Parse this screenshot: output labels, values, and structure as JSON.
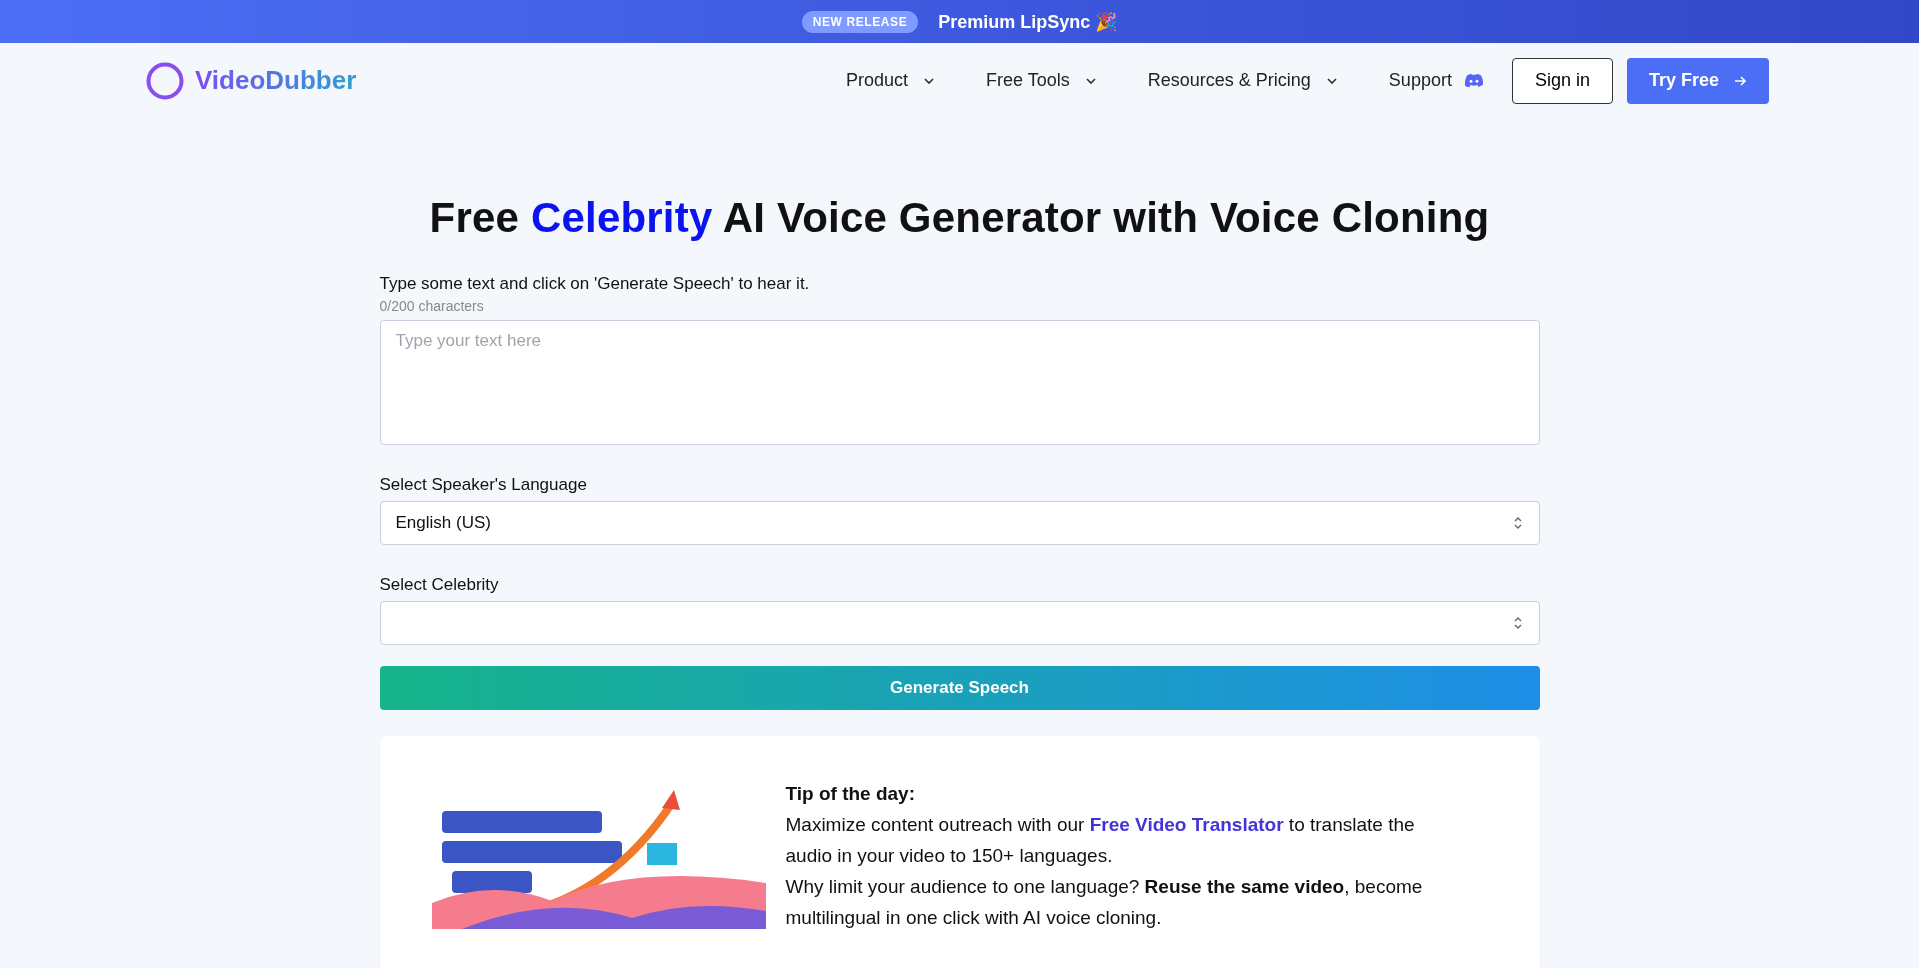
{
  "announcement": {
    "badge": "NEW RELEASE",
    "text": "Premium LipSync 🎉"
  },
  "nav": {
    "logo": "VideoDubber",
    "menus": [
      {
        "label": "Product",
        "dropdown": true
      },
      {
        "label": "Free Tools",
        "dropdown": true
      },
      {
        "label": "Resources & Pricing",
        "dropdown": true
      },
      {
        "label": "Support",
        "dropdown": false
      }
    ],
    "sign_in": "Sign in",
    "try_free": "Try Free"
  },
  "heading": [
    {
      "text": "Free ",
      "highlight": false
    },
    {
      "text": "Celebrity",
      "highlight": true
    },
    {
      "text": " AI Voice Generator with Voice Cloning",
      "highlight": false
    }
  ],
  "form": {
    "instruction": "Type some text and click on 'Generate Speech' to hear it.",
    "counter": "0/200 characters",
    "text_placeholder": "Type your text here",
    "language_label": "Select Speaker's Language",
    "language_value": "English (US)",
    "celebrity_label": "Select Celebrity",
    "generate_button": "Generate Speech"
  },
  "tip": {
    "title": "Tip of the day:",
    "paragraphs": [
      [
        {
          "kind": "text",
          "text": "Maximize content outreach with our "
        },
        {
          "kind": "link",
          "text": "Free Video Translator"
        },
        {
          "kind": "text",
          "text": " to translate the audio in your video to 150+ languages."
        }
      ],
      [
        {
          "kind": "text",
          "text": "Why limit your audience to one language? **Reuse the same video**, become multilingual in one click with AI voice cloning."
        }
      ]
    ]
  }
}
